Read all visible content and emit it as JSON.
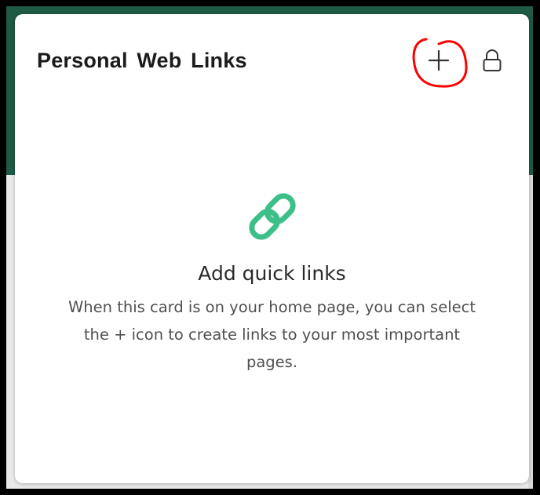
{
  "card": {
    "title": "Personal Web Links",
    "add_icon": "plus-icon",
    "lock_icon": "lock-icon"
  },
  "empty_state": {
    "icon": "link-icon",
    "heading": "Add quick links",
    "description": "When this card is on your home page, you can select the + icon to create links to your most important pages."
  },
  "colors": {
    "header_band": "#1e5a44",
    "link_icon": "#3dbf8a",
    "annotation": "#ff0000"
  }
}
